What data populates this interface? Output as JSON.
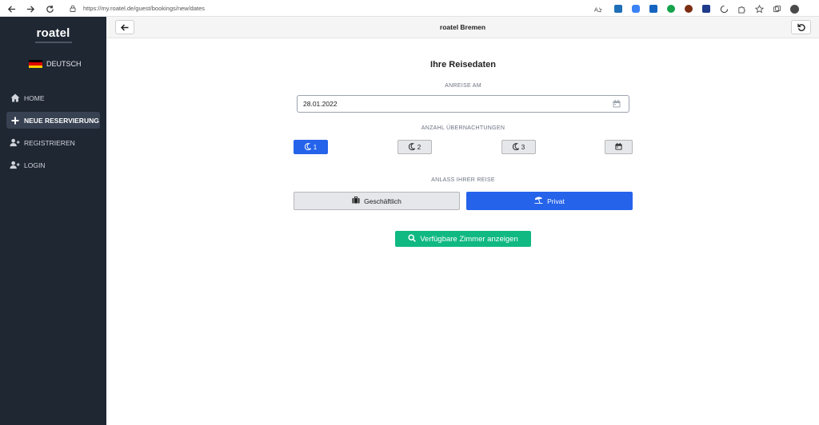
{
  "browser": {
    "url": "https://my.roatel.de/guest/bookings/new/dates"
  },
  "sidebar": {
    "logo": "roatel",
    "language": "DEUTSCH",
    "items": [
      {
        "label": "HOME",
        "icon": "home-icon"
      },
      {
        "label": "NEUE RESERVIERUNG",
        "icon": "plus-icon",
        "active": true
      },
      {
        "label": "REGISTRIEREN",
        "icon": "user-plus-icon"
      },
      {
        "label": "LOGIN",
        "icon": "user-plus-icon"
      }
    ]
  },
  "topbar": {
    "title": "roatel Bremen"
  },
  "main": {
    "heading": "Ihre Reisedaten",
    "arrival_label": "ANREISE AM",
    "arrival_value": "28.01.2022",
    "nights_label": "ANZAHL ÜBERNACHTUNGEN",
    "nights": [
      "1",
      "2",
      "3"
    ],
    "nights_selected": "1",
    "purpose_label": "ANLASS IHRER REISE",
    "purpose_business": "Geschäftlich",
    "purpose_private": "Privat",
    "purpose_selected": "Privat",
    "search_button": "Verfügbare Zimmer anzeigen"
  },
  "colors": {
    "sidebar_bg": "#1f2733",
    "primary": "#2563eb",
    "success": "#10b981"
  }
}
